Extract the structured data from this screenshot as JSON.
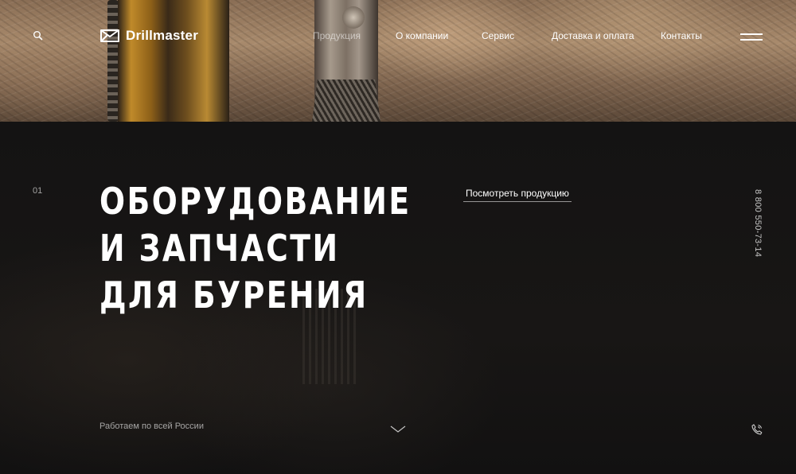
{
  "brand": {
    "name": "Drillmaster"
  },
  "header": {
    "search_icon": "search-icon",
    "menu_icon": "hamburger-menu-icon"
  },
  "nav": {
    "items": [
      {
        "label": "Продукция",
        "active": true
      },
      {
        "label": "О компании",
        "active": false
      },
      {
        "label": "Сервис",
        "active": false
      },
      {
        "label": "Доставка и оплата",
        "active": false
      },
      {
        "label": "Контакты",
        "active": false
      }
    ]
  },
  "hero": {
    "slide_number": "01",
    "title_lines": [
      "ОБОРУДОВАНИЕ",
      "И ЗАПЧАСТИ",
      "ДЛЯ БУРЕНИЯ"
    ],
    "cta_label": "Посмотреть продукцию",
    "phone": "8 800 550-73-14",
    "region_text": "Работаем по всей России",
    "scroll_icon": "chevron-down-icon",
    "phone_icon": "phone-icon"
  },
  "colors": {
    "background": "#121111",
    "text": "#ffffff",
    "muted": "#9a9a9a"
  }
}
